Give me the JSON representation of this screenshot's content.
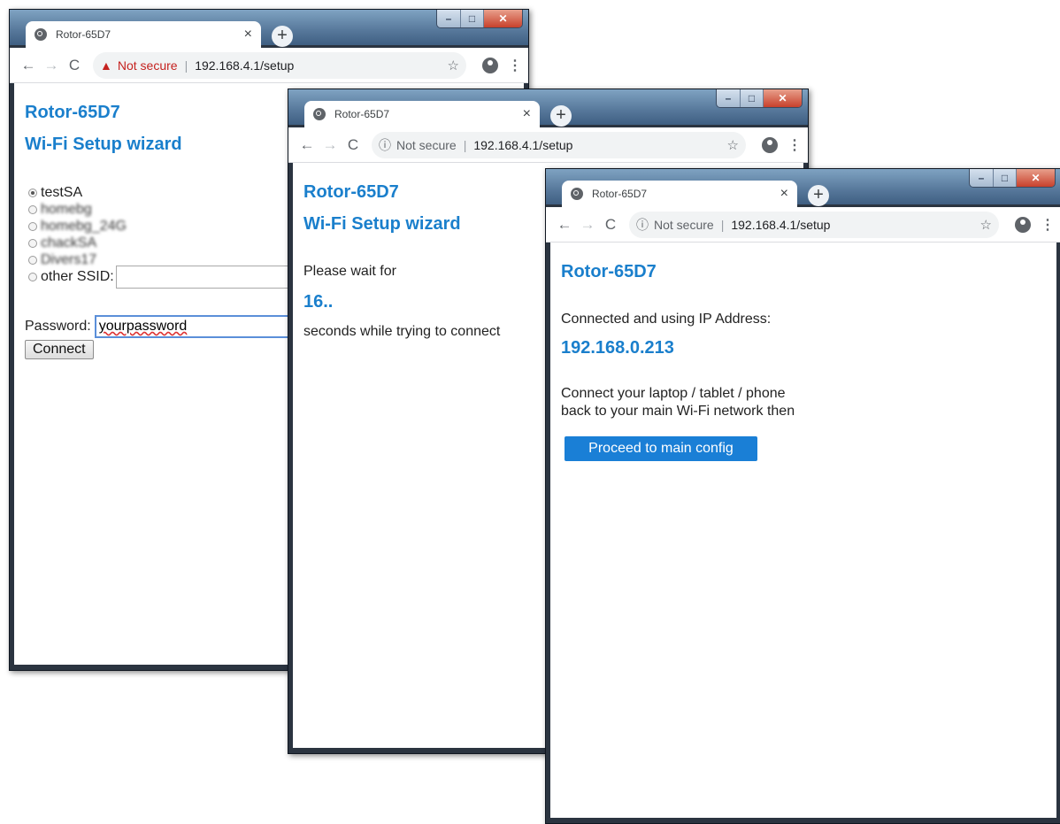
{
  "windows": [
    {
      "tab_title": "Rotor-65D7",
      "security_label": "Not secure",
      "url": "192.168.4.1/setup",
      "heading": "Rotor-65D7",
      "subheading": "Wi-Fi Setup wizard",
      "networks": [
        "testSA",
        "homebg",
        "homebg_24G",
        "chackSA",
        "Divers17"
      ],
      "selected_network": "testSA",
      "other_ssid_label": "other SSID:",
      "password_label": "Password:",
      "password_value": "yourpassword",
      "connect_label": "Connect"
    },
    {
      "tab_title": "Rotor-65D7",
      "security_label": "Not secure",
      "url": "192.168.4.1/setup",
      "heading": "Rotor-65D7",
      "subheading": "Wi-Fi Setup wizard",
      "wait_prefix": "Please wait for",
      "countdown": "16..",
      "wait_suffix": "seconds while trying to connect"
    },
    {
      "tab_title": "Rotor-65D7",
      "security_label": "Not secure",
      "url": "192.168.4.1/setup",
      "heading": "Rotor-65D7",
      "connected_text": "Connected and using IP Address:",
      "ip_address": "192.168.0.213",
      "instruction_line1": "Connect your laptop / tablet / phone",
      "instruction_line2": "back to your main Wi-Fi network then",
      "proceed_label": "Proceed to main config"
    }
  ],
  "icons": {
    "back": "←",
    "forward": "→",
    "reload": "C",
    "star": "☆",
    "menu": "⋮",
    "new_tab": "+",
    "close_tab": "×",
    "warning": "▲",
    "info": "ⓘ"
  }
}
